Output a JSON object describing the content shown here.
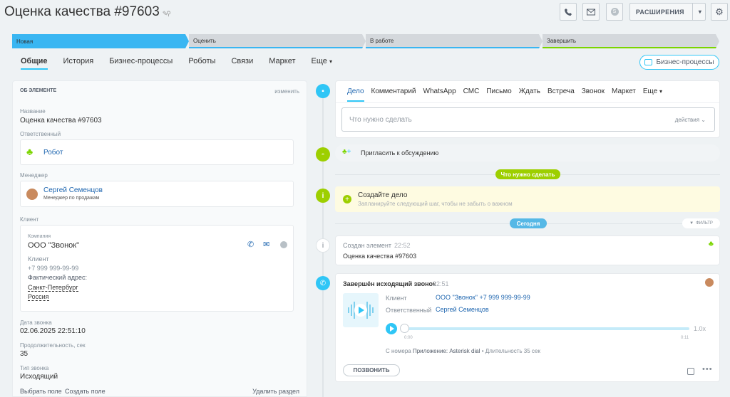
{
  "header": {
    "title": "Оценка качества #97603",
    "extensions_label": "РАСШИРЕНИЯ"
  },
  "stages": [
    {
      "label": "Новая",
      "color": "#39b6f2"
    },
    {
      "label": "Оценить",
      "color": "#d1d5d9"
    },
    {
      "label": "В работе",
      "color": "#d1d5d9"
    },
    {
      "label": "Завершить",
      "color": "#d1d5d9"
    }
  ],
  "tabs": [
    "Общие",
    "История",
    "Бизнес-процессы",
    "Роботы",
    "Связи",
    "Маркет",
    "Еще"
  ],
  "bp_button": "Бизнес-процессы",
  "left": {
    "section_title": "ОБ ЭЛЕМЕНТЕ",
    "edit": "изменить",
    "name_label": "Название",
    "name_value": "Оценка качества #97603",
    "resp_label": "Ответственный",
    "resp_value": "Робот",
    "manager_label": "Менеджер",
    "manager_name": "Сергей Семенцов",
    "manager_role": "Менеджер по продажам",
    "client_label": "Клиент",
    "company_label": "Компания",
    "company_value": "ООО \"Звонок\"",
    "client_sub_label": "Клиент",
    "client_phone": "+7 999 999-99-99",
    "address_label": "Фактический адрес:",
    "city": "Санкт-Петербург",
    "country": "Россия",
    "date_label": "Дата звонка",
    "date_value": "02.06.2025 22:51:10",
    "duration_label": "Продолжительность, сек",
    "duration_value": "35",
    "type_label": "Тип звонка",
    "type_value": "Исходящий",
    "choose_field": "Выбрать поле",
    "create_field": "Создать поле",
    "delete_section": "Удалить раздел"
  },
  "editor": {
    "tabs": [
      "Дело",
      "Комментарий",
      "WhatsApp",
      "СМС",
      "Письмо",
      "Ждать",
      "Встреча",
      "Звонок",
      "Маркет",
      "Еще"
    ],
    "placeholder": "Что нужно сделать",
    "actions": "действия"
  },
  "invite": "Пригласить к обсуждению",
  "todo_pill": "Что нужно сделать",
  "create_task": {
    "title": "Создайте дело",
    "subtitle": "Запланируйте следующий шаг, чтобы не забыть о важном"
  },
  "today_pill": "Сегодня",
  "filter": "ФИЛЬТР",
  "created": {
    "title": "Создан элемент",
    "time": "22:52",
    "text": "Оценка качества #97603"
  },
  "call": {
    "title": "Завершён исходящий звонок",
    "time": "22:51",
    "client_label": "Клиент",
    "client_value": "ООО \"Звонок\"",
    "client_phone": "+7 999 999-99-99",
    "resp_label": "Ответственный",
    "resp_value": "Сергей Семенцов",
    "speed": "1.0x",
    "t_start": "0:00",
    "t_end": "0:11",
    "from_label": "С номера",
    "from_value": "Приложение: Asterisk dial",
    "duration": "• Длительность 35 сек",
    "call_button": "ПОЗВОНИТЬ"
  },
  "colors": {
    "accent": "#2fc6f6",
    "green": "#9dcf00",
    "link": "#2067b0"
  }
}
